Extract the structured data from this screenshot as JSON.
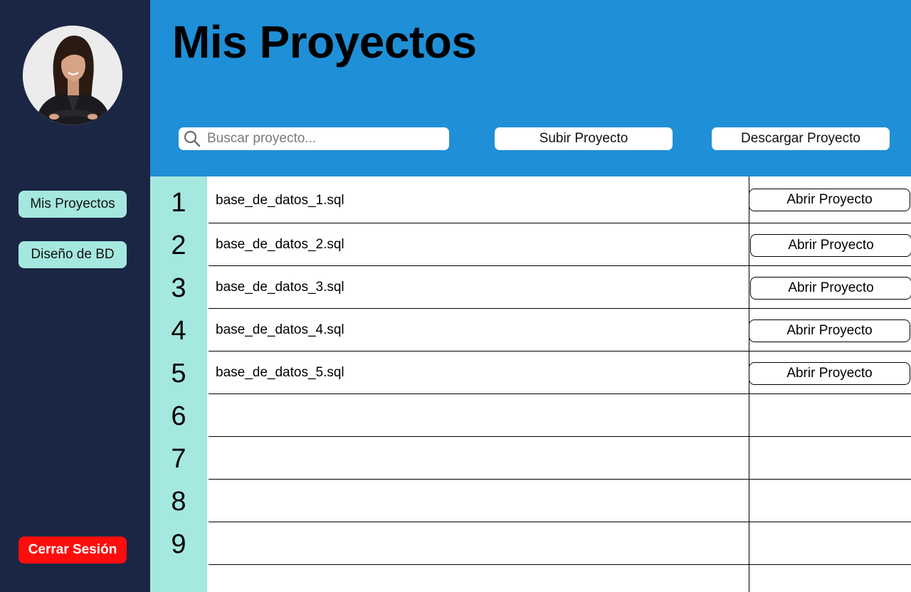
{
  "sidebar": {
    "nav": [
      {
        "label": "Mis Proyectos"
      },
      {
        "label": "Diseño de BD"
      }
    ],
    "logout_label": "Cerrar Sesión"
  },
  "header": {
    "title": "Mis Proyectos",
    "search_placeholder": "Buscar proyecto...",
    "search_icon": "search-icon",
    "upload_label": "Subir Proyecto",
    "download_label": "Descargar Proyecto"
  },
  "table": {
    "row_numbers": [
      "1",
      "2",
      "3",
      "4",
      "5",
      "6",
      "7",
      "8",
      "9"
    ],
    "rows": [
      {
        "file": "base_de_datos_1.sql",
        "action": "Abrir Proyecto"
      },
      {
        "file": "base_de_datos_2.sql",
        "action": "Abrir Proyecto"
      },
      {
        "file": "base_de_datos_3.sql",
        "action": "Abrir Proyecto"
      },
      {
        "file": "base_de_datos_4.sql",
        "action": "Abrir Proyecto"
      },
      {
        "file": "base_de_datos_5.sql",
        "action": "Abrir Proyecto"
      }
    ]
  },
  "colors": {
    "sidebar_bg": "#1b2644",
    "header_bg": "#1f8fd7",
    "accent": "#a5e8df",
    "logout": "#ff0d0d"
  }
}
